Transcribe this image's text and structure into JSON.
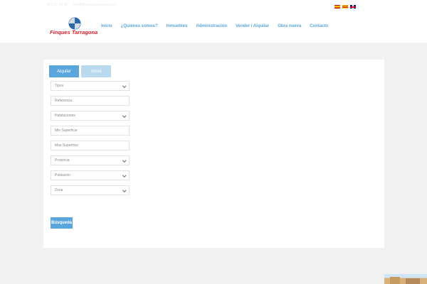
{
  "topbar": {
    "phone": "977 21 98 38",
    "email": "info@finquestarragona.com",
    "languages": [
      {
        "code": "es",
        "icon": "spain-flag-icon"
      },
      {
        "code": "ca",
        "icon": "catalonia-flag-icon"
      },
      {
        "code": "en",
        "icon": "uk-flag-icon"
      }
    ]
  },
  "header": {
    "logo_text": "Finques Tarragona",
    "nav": [
      "Inicio",
      "¿Quiénes somos?",
      "Inmuebles",
      "Administración",
      "Vender / Alquilar",
      "Obra nueva",
      "Contacto"
    ]
  },
  "search": {
    "tabs": [
      {
        "label": "Alquiler",
        "active": true
      },
      {
        "label": "Venta",
        "active": false
      }
    ],
    "fields": {
      "tipos": "Tipos",
      "referencia": "Referencia",
      "habitaciones": "Habitaciones",
      "min_superficie": "Min Superficie",
      "max_superficie": "Max Superficie",
      "provincia": "Provincia",
      "poblacion": "Población",
      "zona": "Zona"
    },
    "button": "Búsqueda"
  },
  "colors": {
    "accent": "#5aa6dc",
    "accent_light": "#b9d9ee",
    "logo_red": "#d81e2a",
    "background": "#f1f1f1"
  }
}
